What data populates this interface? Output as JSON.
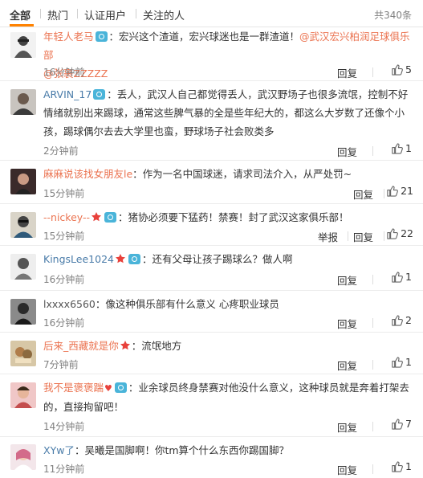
{
  "tabs": [
    {
      "label": "全部",
      "active": true
    },
    {
      "label": "热门",
      "active": false
    },
    {
      "label": "认证用户",
      "active": false
    },
    {
      "label": "关注的人",
      "active": false
    }
  ],
  "total": "共340条",
  "reply_label": "回复",
  "report_label": "举报",
  "accent_color": "#ff8200",
  "comments": [
    {
      "user": "年轻人老马",
      "text": "：宏兴这个渣道，宏兴球迷也是一群渣道！",
      "mention1": "@武汉宏兴柏润足球俱乐部",
      "mention2": "@张裹ZZZZZ",
      "time": "16分钟前",
      "likes": "5"
    },
    {
      "user": "ARVIN_17",
      "text": "：丢人，武汉人自己都觉得丢人，武汉野场子也很多流氓，控制不好情绪就别出来踢球，通常这些脾气暴的全是些年纪大的，都这么大岁数了还像个小孩，踢球偶尔去去大学里也蛮，野球场子社会败类多",
      "time": "2分钟前",
      "likes": "1"
    },
    {
      "user": "麻麻说该找女朋友le",
      "text": "：作为一名中国球迷，请求司法介入，从严处罚~",
      "time": "15分钟前",
      "likes": "21"
    },
    {
      "user": "--nickey--",
      "text": "：猪协必须要下猛药！禁赛！封了武汉这家俱乐部！",
      "time": "15分钟前",
      "likes": "22"
    },
    {
      "user": "KingsLee1024",
      "text": "：还有父母让孩子踢球么？做人啊",
      "time": "16分钟前",
      "likes": "1"
    },
    {
      "user": "lxxxx6560",
      "text": "：像这种俱乐部有什么意义 心疼职业球员",
      "time": "16分钟前",
      "likes": "2"
    },
    {
      "user": "后来_西藏就是你",
      "text": "：流氓地方",
      "time": "7分钟前",
      "likes": "1"
    },
    {
      "user": "我不是褒褒踹",
      "text": "：业余球员终身禁赛对他没什么意义，这种球员就是奔着打架去的，直接拘留吧！",
      "time": "14分钟前",
      "likes": "7"
    },
    {
      "user": "XYw了",
      "text": "：吴曦是国脚啊！你tm算个什么东西你踢国脚？",
      "time": "11分钟前",
      "likes": "1"
    }
  ]
}
